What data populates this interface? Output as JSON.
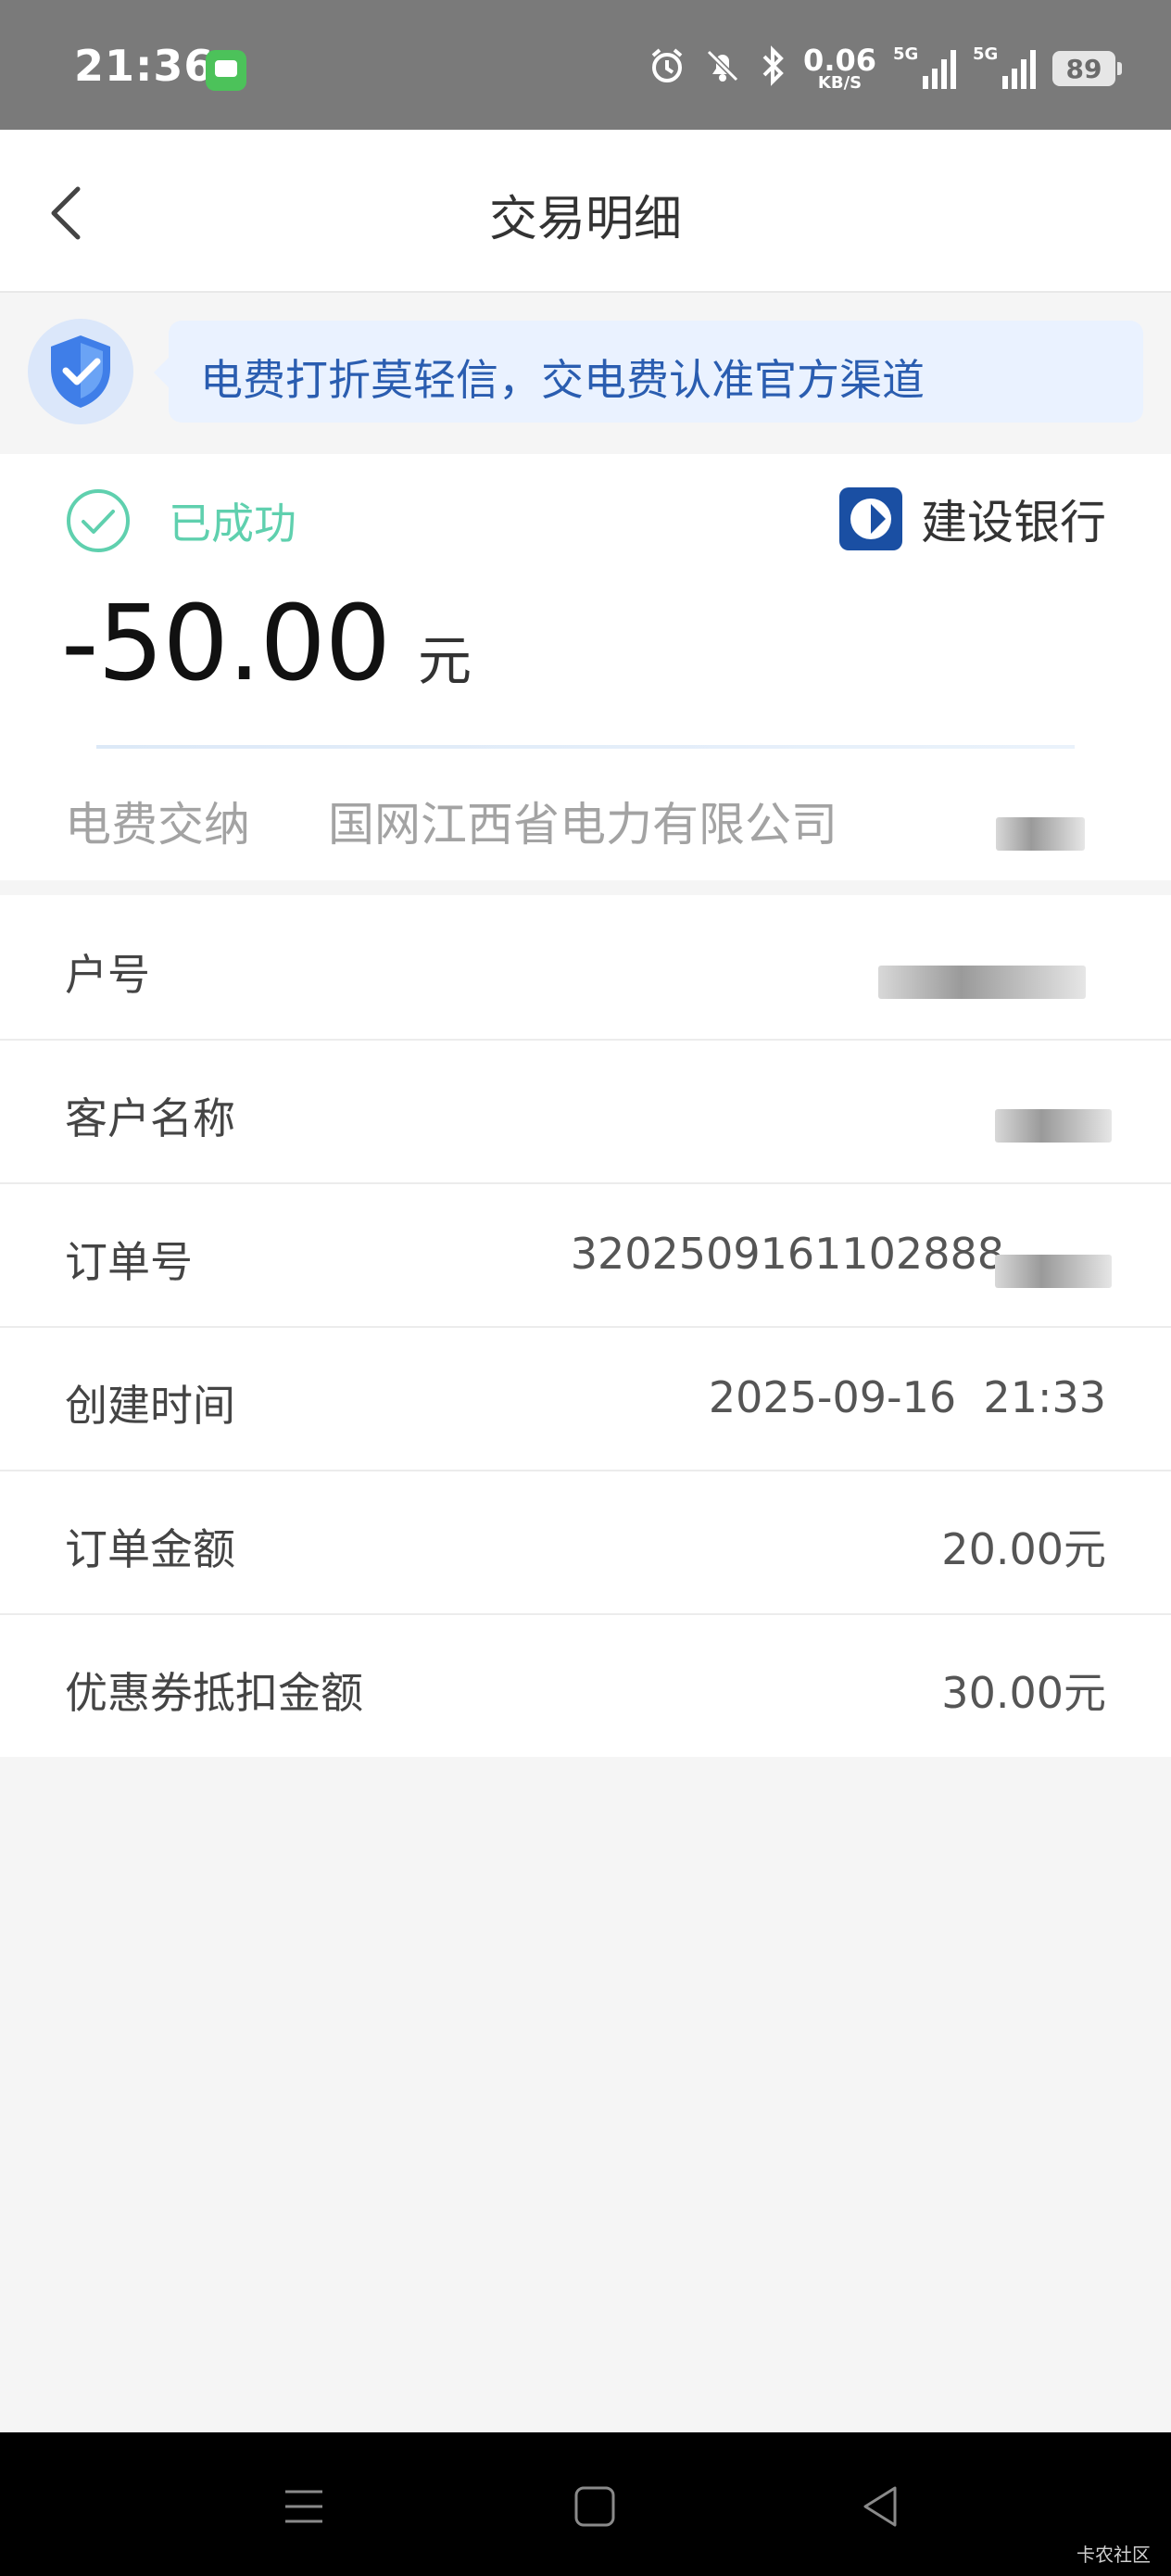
{
  "status_bar": {
    "time": "21:36",
    "net_speed_value": "0.06",
    "net_speed_unit": "KB/S",
    "sim1_label": "5G",
    "sim2_label": "5G",
    "battery": "89",
    "icons": [
      "message-app-icon",
      "alarm-icon",
      "mute-icon",
      "bluetooth-icon",
      "signal-icon",
      "battery-icon"
    ]
  },
  "header": {
    "title": "交易明细"
  },
  "notice": {
    "text": "电费打折莫轻信，交电费认准官方渠道"
  },
  "summary": {
    "status": "已成功",
    "bank": "建设银行",
    "amount": "-50.00",
    "unit": "元",
    "category": "电费交纳",
    "merchant": "国网江西省电力有限公司"
  },
  "details": [
    {
      "label": "户号",
      "value": ""
    },
    {
      "label": "客户名称",
      "value": ""
    },
    {
      "label": "订单号",
      "value": "32025091611028​88"
    },
    {
      "label": "创建时间",
      "value": "2025-09-16  21:33"
    },
    {
      "label": "订单金额",
      "value": "20.00元"
    },
    {
      "label": "优惠券抵扣金额",
      "value": "30.00元"
    }
  ],
  "watermark": "卡农社区",
  "colors": {
    "success": "#5fd0ae",
    "notice_text": "#2a5db0",
    "bank_blue": "#1a4fa3"
  }
}
